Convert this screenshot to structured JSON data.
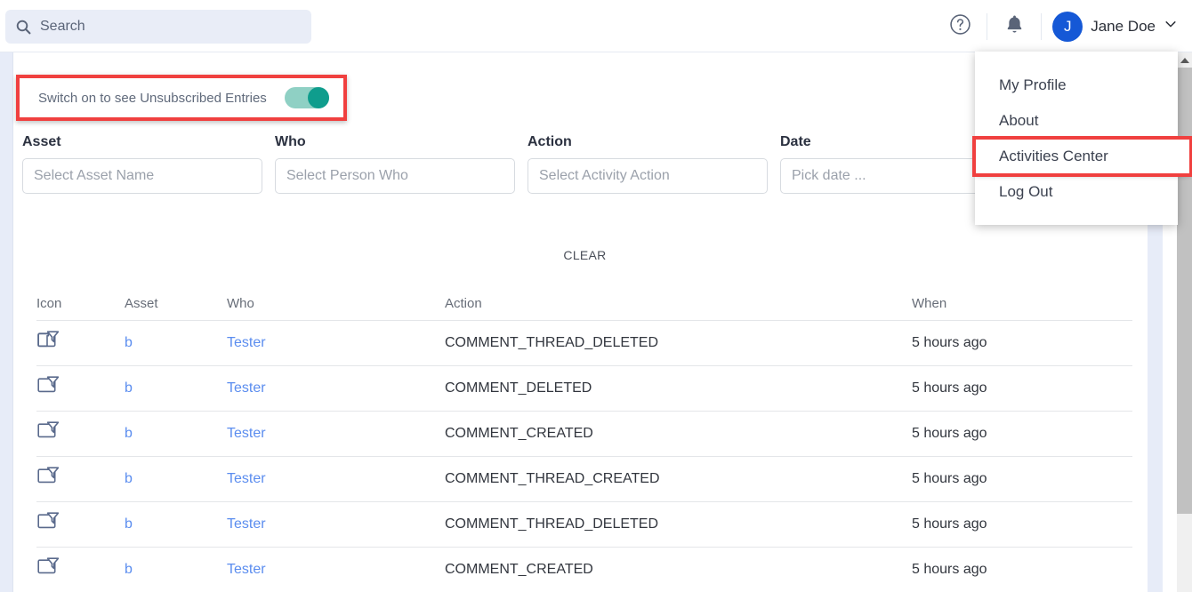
{
  "header": {
    "search": {
      "placeholder": "Search",
      "icon": "search-icon"
    },
    "help_icon": "help-circle-icon",
    "bell_icon": "notification-bell-icon",
    "user": {
      "avatar_initial": "J",
      "name": "Jane Doe",
      "chevron": "chevron-down-icon"
    }
  },
  "user_menu": {
    "items": [
      {
        "label": "My Profile",
        "highlighted": false
      },
      {
        "label": "About",
        "highlighted": false
      },
      {
        "label": "Activities Center",
        "highlighted": true
      },
      {
        "label": "Log Out",
        "highlighted": false
      }
    ],
    "highlight_color": "#f0403f"
  },
  "toggle": {
    "label": "Switch on to see Unsubscribed Entries",
    "state": "on",
    "track_color": "#8fd0c4",
    "knob_color": "#0f9d8d",
    "highlight_color": "#f0403f"
  },
  "filters": [
    {
      "label": "Asset",
      "placeholder": "Select Asset Name",
      "value": ""
    },
    {
      "label": "Who",
      "placeholder": "Select Person Who",
      "value": ""
    },
    {
      "label": "Action",
      "placeholder": "Select Activity Action",
      "value": ""
    },
    {
      "label": "Date",
      "placeholder": "Pick date ...",
      "value": ""
    }
  ],
  "clear_button": "CLEAR",
  "table": {
    "columns": [
      "Icon",
      "Asset",
      "Who",
      "Action",
      "When"
    ],
    "rows": [
      {
        "icon": "comment-thread-icon",
        "asset": "b",
        "who": "Tester",
        "action": "COMMENT_THREAD_DELETED",
        "when": "5 hours ago"
      },
      {
        "icon": "comment-thread-icon",
        "asset": "b",
        "who": "Tester",
        "action": "COMMENT_DELETED",
        "when": "5 hours ago"
      },
      {
        "icon": "comment-thread-icon",
        "asset": "b",
        "who": "Tester",
        "action": "COMMENT_CREATED",
        "when": "5 hours ago"
      },
      {
        "icon": "comment-thread-icon",
        "asset": "b",
        "who": "Tester",
        "action": "COMMENT_THREAD_CREATED",
        "when": "5 hours ago"
      },
      {
        "icon": "comment-thread-icon",
        "asset": "b",
        "who": "Tester",
        "action": "COMMENT_THREAD_DELETED",
        "when": "5 hours ago"
      },
      {
        "icon": "comment-thread-icon",
        "asset": "b",
        "who": "Tester",
        "action": "COMMENT_CREATED",
        "when": "5 hours ago"
      }
    ]
  },
  "scrollbar": {
    "up_arrow": "scroll-up-arrow-icon"
  },
  "colors": {
    "link": "#5b8def",
    "avatar": "#1558d6",
    "rail": "#e7ecf8"
  }
}
